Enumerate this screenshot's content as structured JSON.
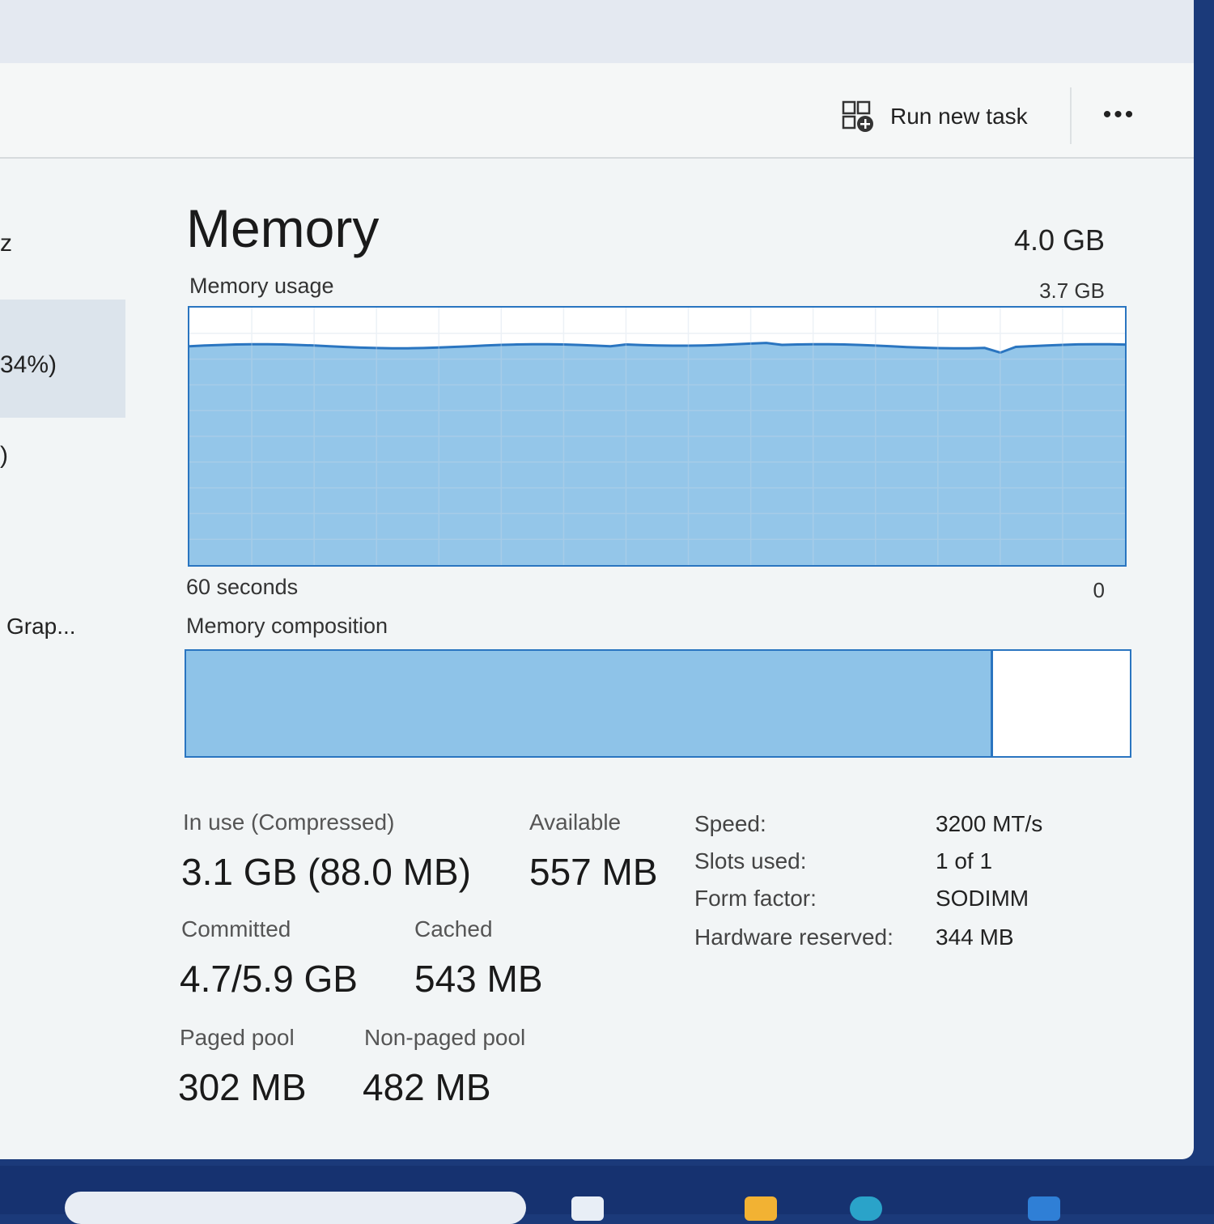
{
  "toolbar": {
    "run_new_task_label": "Run new task",
    "more_label": "•••"
  },
  "sidebar": {
    "fragments": [
      "z",
      "34%)",
      ")",
      "Grap..."
    ]
  },
  "header": {
    "title": "Memory",
    "total": "4.0 GB"
  },
  "usage_graph": {
    "label": "Memory usage",
    "max_label": "3.7 GB",
    "time_label": "60 seconds",
    "end_label": "0",
    "fill_color": "#8ec3e8",
    "line_color": "#2a75c0",
    "level_fraction": 0.85
  },
  "composition": {
    "label": "Memory composition",
    "in_use_fraction": 0.855
  },
  "stats": {
    "in_use_label": "In use (Compressed)",
    "in_use_value": "3.1 GB (88.0 MB)",
    "available_label": "Available",
    "available_value": "557 MB",
    "committed_label": "Committed",
    "committed_value": "4.7/5.9 GB",
    "cached_label": "Cached",
    "cached_value": "543 MB",
    "paged_pool_label": "Paged pool",
    "paged_pool_value": "302 MB",
    "non_paged_pool_label": "Non-paged pool",
    "non_paged_pool_value": "482 MB"
  },
  "specs": {
    "speed_label": "Speed:",
    "speed_value": "3200 MT/s",
    "slots_label": "Slots used:",
    "slots_value": "1 of 1",
    "form_factor_label": "Form factor:",
    "form_factor_value": "SODIMM",
    "hw_reserved_label": "Hardware reserved:",
    "hw_reserved_value": "344 MB"
  }
}
